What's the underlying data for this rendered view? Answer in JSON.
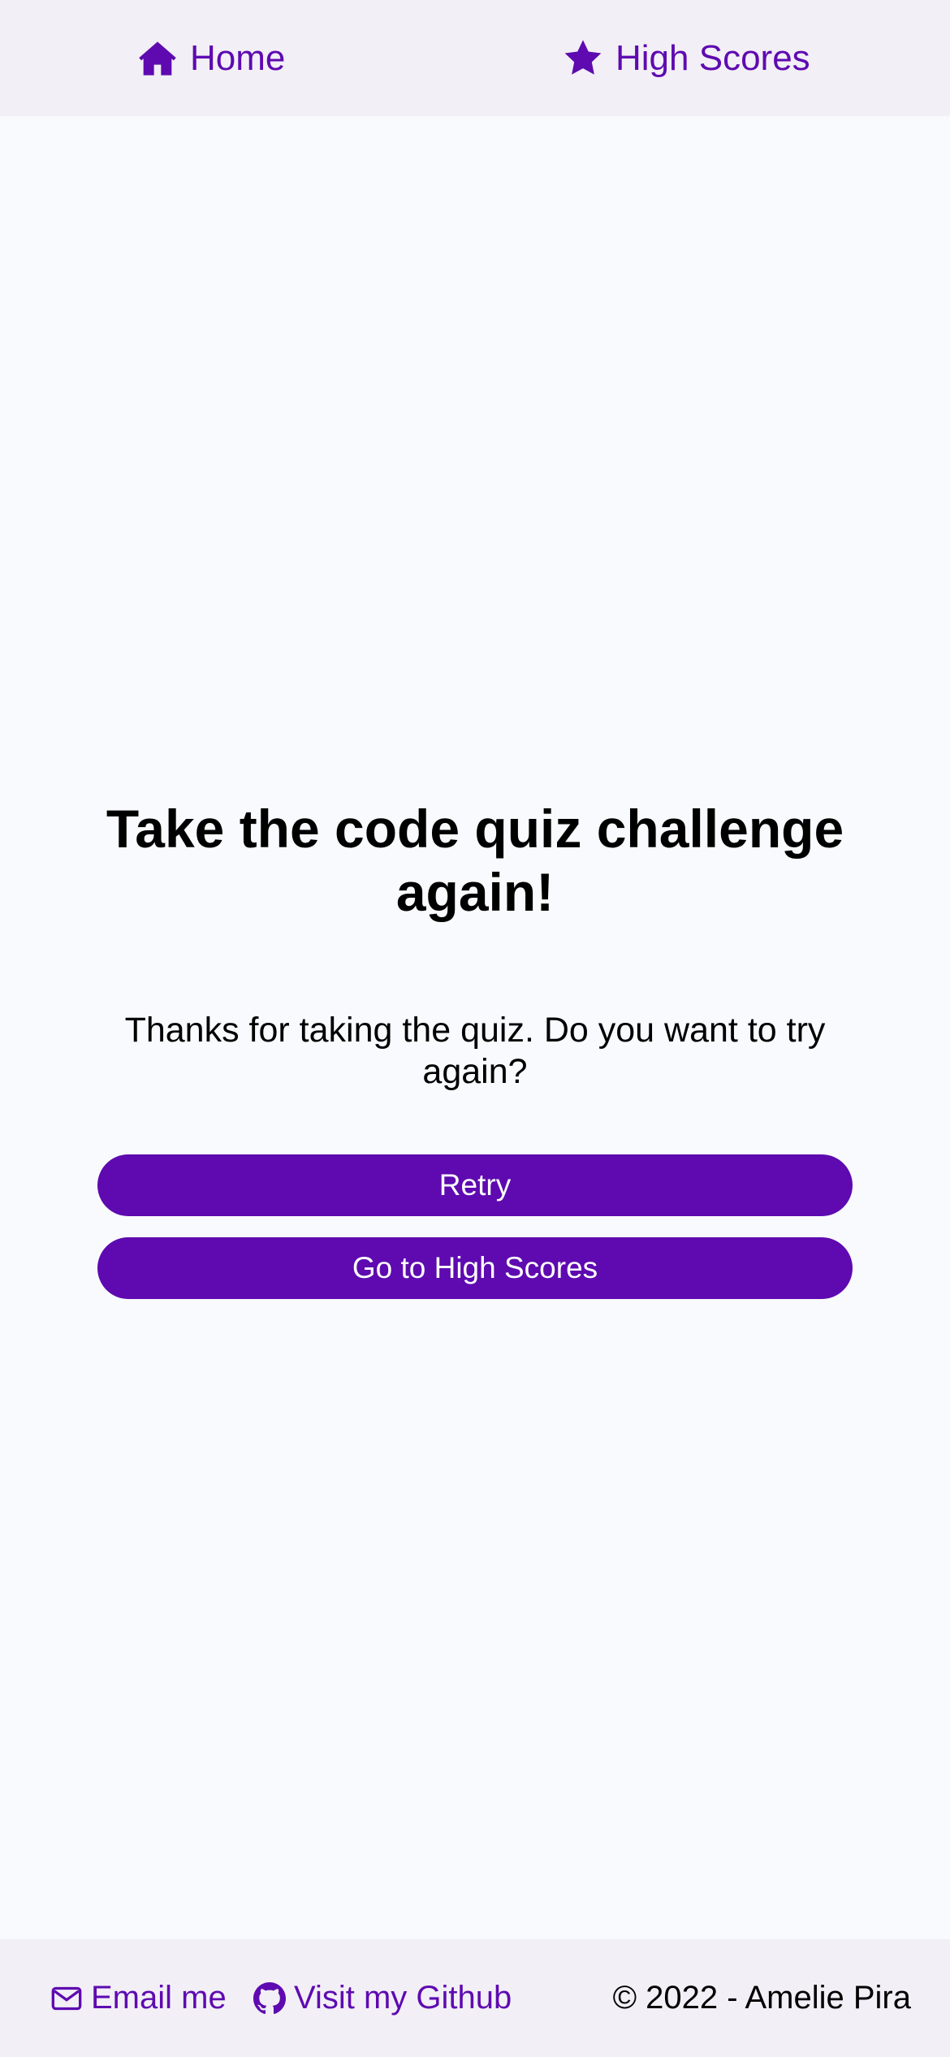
{
  "nav": {
    "home_label": "Home",
    "home_icon": "home-icon",
    "highscores_label": "High Scores",
    "highscores_icon": "star-icon"
  },
  "main": {
    "title": "Take the code quiz challenge again!",
    "message": "Thanks for taking the quiz. Do you want to try again?",
    "retry_label": "Retry",
    "highscores_button_label": "Go to High Scores"
  },
  "footer": {
    "email_label": "Email me",
    "email_icon": "envelope-icon",
    "github_label": "Visit my Github",
    "github_icon": "github-icon",
    "copyright": "© 2022 - Amelie Pira"
  },
  "colors": {
    "accent": "#5e0ab0",
    "bar_background": "#f2eff6",
    "page_background": "#f9fafd"
  }
}
